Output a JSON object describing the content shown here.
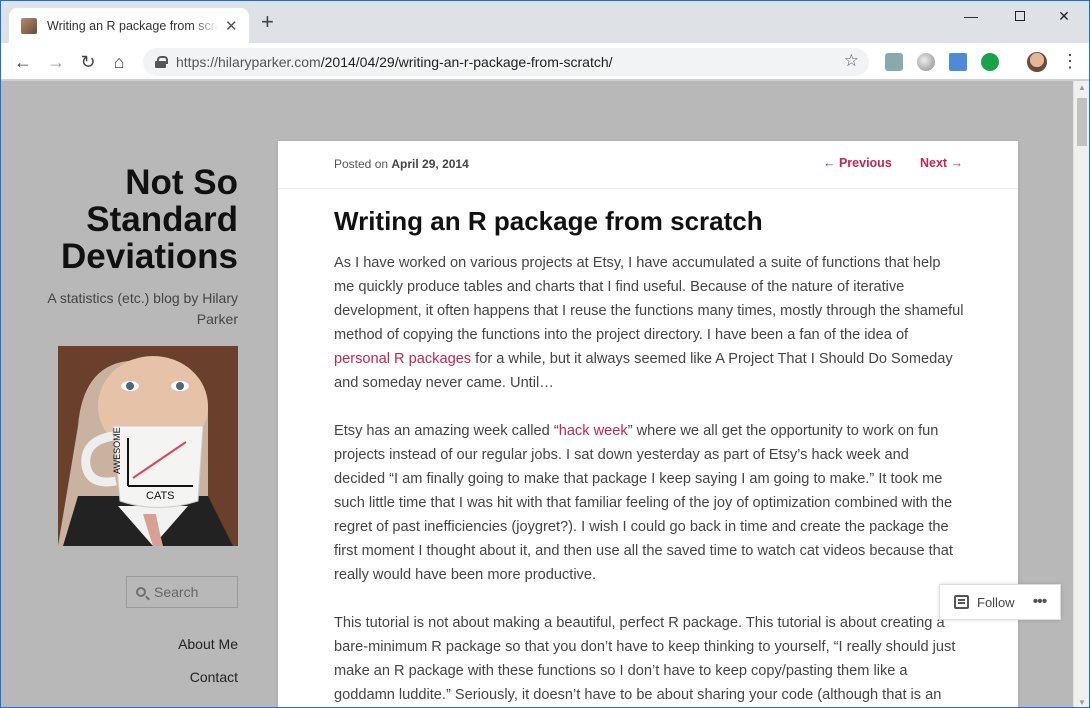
{
  "browser": {
    "tab_title": "Writing an R package from scratch",
    "new_tab_label": "+",
    "url_domain": "https://hilaryparker.com",
    "url_path": "/2014/04/29/writing-an-r-package-from-scratch/"
  },
  "sidebar": {
    "site_title": "Not So Standard Deviations",
    "site_description": "A statistics (etc.) blog by Hilary Parker",
    "mug_label_awesome": "AWESOME",
    "mug_label_cats": "CATS",
    "search_placeholder": "Search",
    "links": [
      "About Me",
      "Contact"
    ]
  },
  "post": {
    "posted_on_prefix": "Posted on",
    "posted_date": "April 29, 2014",
    "prev_label": "← Previous",
    "next_label": "Next →",
    "title": "Writing an R package from scratch",
    "p1_a": "As I have worked on various projects at Etsy, I have accumulated a suite of functions that help me quickly produce tables and charts that I find useful. Because of the nature of iterative development, it often happens that I reuse the functions many times, mostly through the shameful method of copying the functions into the project directory. I have been a fan of the idea of ",
    "p1_link": "personal R packages",
    "p1_b": " for a while, but it always seemed like A Project That I Should Do Someday and someday never came. Until…",
    "p2_a": "Etsy has an amazing week called “",
    "p2_link": "hack week",
    "p2_b": "” where we all get the opportunity to work on fun projects instead of our regular jobs. I sat down yesterday as part of Etsy’s hack week and decided “I am finally going to make that package I keep saying I am going to make.” It took me such little time that I was hit with that familiar feeling of the joy of optimization combined with the regret of past inefficiencies (joygret?). I wish I could go back in time and create the package the first moment I thought about it, and then use all the saved time to watch cat videos because that really would have been more productive.",
    "p3": "This tutorial is not about making a beautiful, perfect R package. This tutorial is about creating a bare-minimum R package so that you don’t have to keep thinking to yourself, “I really should just make an R package with these functions so I don’t have to keep copy/pasting them like a goddamn luddite.” Seriously, it doesn’t have to be about sharing your code (although that is an"
  },
  "follow": {
    "label": "Follow",
    "more": "•••"
  },
  "colors": {
    "accent_link": "#c7254e",
    "page_background": "#b8b8b8"
  }
}
